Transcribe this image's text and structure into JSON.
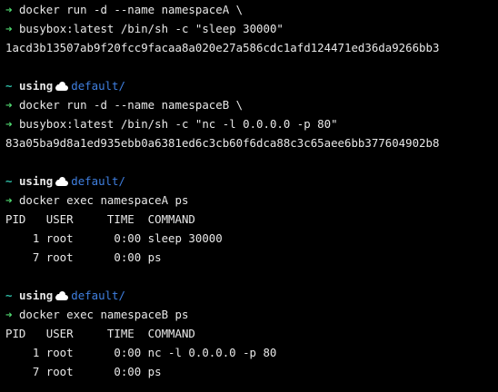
{
  "colors": {
    "background": "#000000",
    "prompt_arrow": "#4fd66f",
    "tilde": "#2fbfa8",
    "context": "#3f7fe0",
    "text": "#e8e8e8"
  },
  "prompt": {
    "arrow": "➜",
    "tilde": "~",
    "using": "using",
    "cloud_icon": "cloud-icon",
    "context": "default/"
  },
  "block1": {
    "cmd1": "docker run -d --name namespaceA \\",
    "cmd2": "busybox:latest /bin/sh -c \"sleep 30000\"",
    "out": "1acd3b13507ab9f20fcc9facaa8a020e27a586cdc1afd124471ed36da9266bb3"
  },
  "block2": {
    "cmd1": "docker run -d --name namespaceB \\",
    "cmd2": "busybox:latest /bin/sh -c \"nc -l 0.0.0.0 -p 80\"",
    "out": "83a05ba9d8a1ed935ebb0a6381ed6c3cb60f6dca88c3c65aee6bb377604902b8"
  },
  "block3": {
    "cmd": "docker exec namespaceA ps",
    "header": "PID   USER     TIME  COMMAND",
    "rows": [
      "    1 root      0:00 sleep 30000",
      "    7 root      0:00 ps"
    ]
  },
  "block4": {
    "cmd": "docker exec namespaceB ps",
    "header": "PID   USER     TIME  COMMAND",
    "rows": [
      "    1 root      0:00 nc -l 0.0.0.0 -p 80",
      "    7 root      0:00 ps"
    ]
  }
}
